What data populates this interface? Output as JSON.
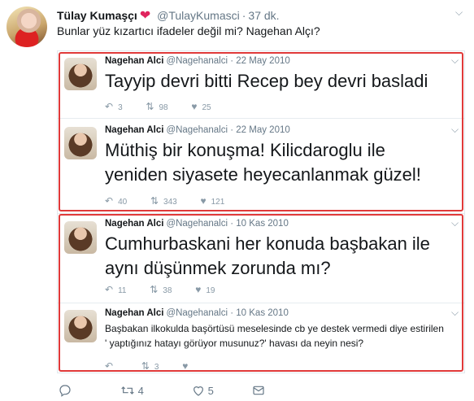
{
  "tweet": {
    "author_name": "Tülay Kumaşçı",
    "heart": "❤",
    "handle": "@TulayKumasci",
    "separator": "·",
    "time": "37 dk.",
    "text": "Bunlar yüz kızartıcı ifadeler değil mi? Nagehan Alçı?",
    "actions": {
      "reply_count": "",
      "retweet_count": "4",
      "like_count": "5"
    }
  },
  "quoted": [
    {
      "name": "Nagehan Alci",
      "handle": "@Nagehanalci · 22 May 2010",
      "text": "Tayyip devri bitti Recep bey devri basladi",
      "replies": "3",
      "retweets": "98",
      "likes": "25"
    },
    {
      "name": "Nagehan Alci",
      "handle": "@Nagehanalci · 22 May 2010",
      "text": "Müthiş bir konuşma! Kilicdaroglu ile yeniden siyasete heyecanlanmak güzel!",
      "replies": "40",
      "retweets": "343",
      "likes": "121"
    },
    {
      "name": "Nagehan Alci",
      "handle": "@Nagehanalci · 10 Kas 2010",
      "text": "Cumhurbaskani her konuda başbakan ile aynı düşünmek zorunda mı?",
      "replies": "11",
      "retweets": "38",
      "likes": "19"
    },
    {
      "name": "Nagehan Alci",
      "handle": "@Nagehanalci · 10 Kas 2010",
      "text": "Başbakan ilkokulda başörtüsü meselesinde cb ye destek vermedi diye estirilen  ' yaptığınız hatayı görüyor musunuz?' havası da neyin nesi?",
      "replies": "",
      "retweets": "3",
      "likes": ""
    }
  ],
  "icons": {
    "reply": "reply-icon",
    "retweet": "retweet-icon",
    "like": "heart-icon",
    "dm": "mail-icon",
    "more": "chevron-down-icon"
  },
  "colors": {
    "accent_red": "#e03a3a",
    "heart": "#e0245e",
    "muted": "#657786"
  }
}
